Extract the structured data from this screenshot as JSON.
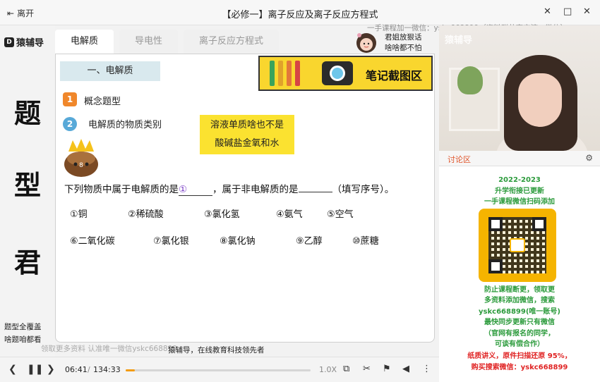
{
  "titlebar": {
    "leave_label": "离开",
    "title": "【必修一】离子反应及离子反应方程式",
    "watermark": "一手课程加一微信：yskc668899（资料群共享交流一微信）"
  },
  "left_column": {
    "logo_text": "猿辅导",
    "logo_mark": "D",
    "big_chars": [
      "题",
      "型",
      "君"
    ],
    "slogan_lines": [
      "题型全覆盖",
      "啥题咱都看"
    ]
  },
  "tabs": [
    {
      "label": "电解质",
      "active": true
    },
    {
      "label": "导电性",
      "active": false
    },
    {
      "label": "离子反应方程式",
      "active": false
    }
  ],
  "host": {
    "line1": "君姐放狠话",
    "line2": "啥啥都不怕"
  },
  "slide": {
    "section_heading": "一、电解质",
    "note_area_label": "笔记截图区",
    "items": [
      {
        "number": "1",
        "label": "概念题型",
        "color": "#f0872b"
      },
      {
        "number": "2",
        "label": "电解质的物质类别",
        "color": "#58a9d8"
      }
    ],
    "yellow_note": [
      "溶液单质啥也不是",
      "酸碱盐金氧和水"
    ],
    "mascot_label": "8",
    "question": {
      "part1": "下列物质中属于电解质的是",
      "filled": "①",
      "part2": "，属于非电解质的是",
      "part3": "（填写序号）。"
    },
    "options": [
      "①铜",
      "②稀硫酸",
      "③氯化氢",
      "④氨气",
      "⑤空气",
      "⑥二氧化碳",
      "⑦氯化银",
      "⑧氯化钠",
      "⑨乙醇",
      "⑩蔗糖"
    ]
  },
  "caption": {
    "watermark": "领取更多资料 认准唯一微信yskc668899",
    "text": "猿辅导，在线教育科技领先者"
  },
  "player": {
    "current_time": "06:41",
    "total_time": "134:33",
    "progress": 0.05,
    "speed": "1.0X"
  },
  "video": {
    "logo_text": "猿辅导"
  },
  "discussion": {
    "label": "讨论区"
  },
  "ad": {
    "green_top": [
      "2022-2023",
      "升学衔接已更新",
      "一手课程微信扫码添加"
    ],
    "green_bottom": [
      "防止课程断更，领取更",
      "多资料添加微信，搜索",
      "yskc668899(唯一账号)",
      "最快同步更新只有微信",
      "（官网有报名的同学，",
      "可谈有偿合作）"
    ],
    "red_lines": [
      "纸质讲义，原件扫描还原 95%，",
      "购买搜索微信：yskc668899"
    ]
  },
  "colors": {
    "accent_orange": "#f39c12",
    "note_yellow": "#f9d62e",
    "section_blue": "#d9e9ee",
    "ad_green": "#2c9b3c",
    "ad_red": "#e02424"
  }
}
